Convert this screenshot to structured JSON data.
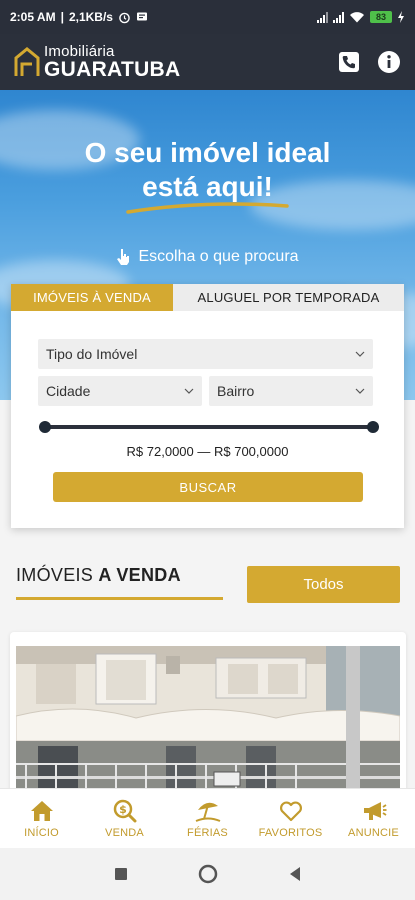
{
  "status_bar": {
    "time": "2:05 AM",
    "speed": "2,1KB/s",
    "battery": "83"
  },
  "header": {
    "logo_top": "Imobiliária",
    "logo_bottom": "GUARATUBA"
  },
  "hero": {
    "title_line1": "O seu imóvel ideal",
    "title_line2": "está aqui!",
    "subtitle": "Escolha o que procura"
  },
  "search": {
    "tabs": [
      {
        "label": "IMÓVEIS À VENDA",
        "active": true
      },
      {
        "label": "ALUGUEL POR TEMPORADA",
        "active": false
      }
    ],
    "tipo_imovel": "Tipo do Imóvel",
    "cidade": "Cidade",
    "bairro": "Bairro",
    "price_min": "R$ 72,0000",
    "price_sep": " — ",
    "price_max": "R$ 700,0000",
    "price_range_text": "R$ 72,0000 — R$ 700,0000",
    "button": "BUSCAR"
  },
  "section": {
    "title_prefix": "IMÓVEIS ",
    "title_bold": "A VENDA",
    "todos": "Todos"
  },
  "bottom_nav": [
    {
      "label": "INÍCIO",
      "icon": "home-icon"
    },
    {
      "label": "VENDA",
      "icon": "money-search-icon"
    },
    {
      "label": "FÉRIAS",
      "icon": "beach-umbrella-icon"
    },
    {
      "label": "FAVORITOS",
      "icon": "heart-icon"
    },
    {
      "label": "ANUNCIE",
      "icon": "megaphone-icon"
    }
  ],
  "colors": {
    "brand_gold": "#d4a931",
    "header_dark": "#2b303b"
  }
}
